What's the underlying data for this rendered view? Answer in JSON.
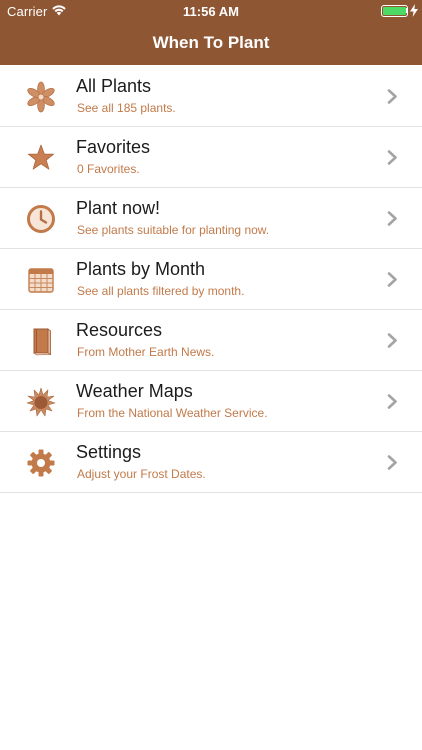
{
  "status": {
    "carrier": "Carrier",
    "time": "11:56 AM",
    "battery_level": 1.0
  },
  "nav": {
    "title": "When To Plant"
  },
  "accent_color": "#c27a4a",
  "header_color": "#8f5634",
  "menu": [
    {
      "title": "All Plants",
      "subtitle": "See all 185 plants.",
      "icon": "flower-icon"
    },
    {
      "title": "Favorites",
      "subtitle": "0 Favorites.",
      "icon": "star-icon"
    },
    {
      "title": "Plant now!",
      "subtitle": "See plants suitable for planting now.",
      "icon": "clock-icon"
    },
    {
      "title": "Plants by Month",
      "subtitle": "See all plants filtered by month.",
      "icon": "calendar-icon"
    },
    {
      "title": "Resources",
      "subtitle": "From Mother Earth News.",
      "icon": "book-icon"
    },
    {
      "title": "Weather Maps",
      "subtitle": "From the National Weather Service.",
      "icon": "sun-icon"
    },
    {
      "title": "Settings",
      "subtitle": "Adjust your Frost Dates.",
      "icon": "gear-icon"
    }
  ]
}
